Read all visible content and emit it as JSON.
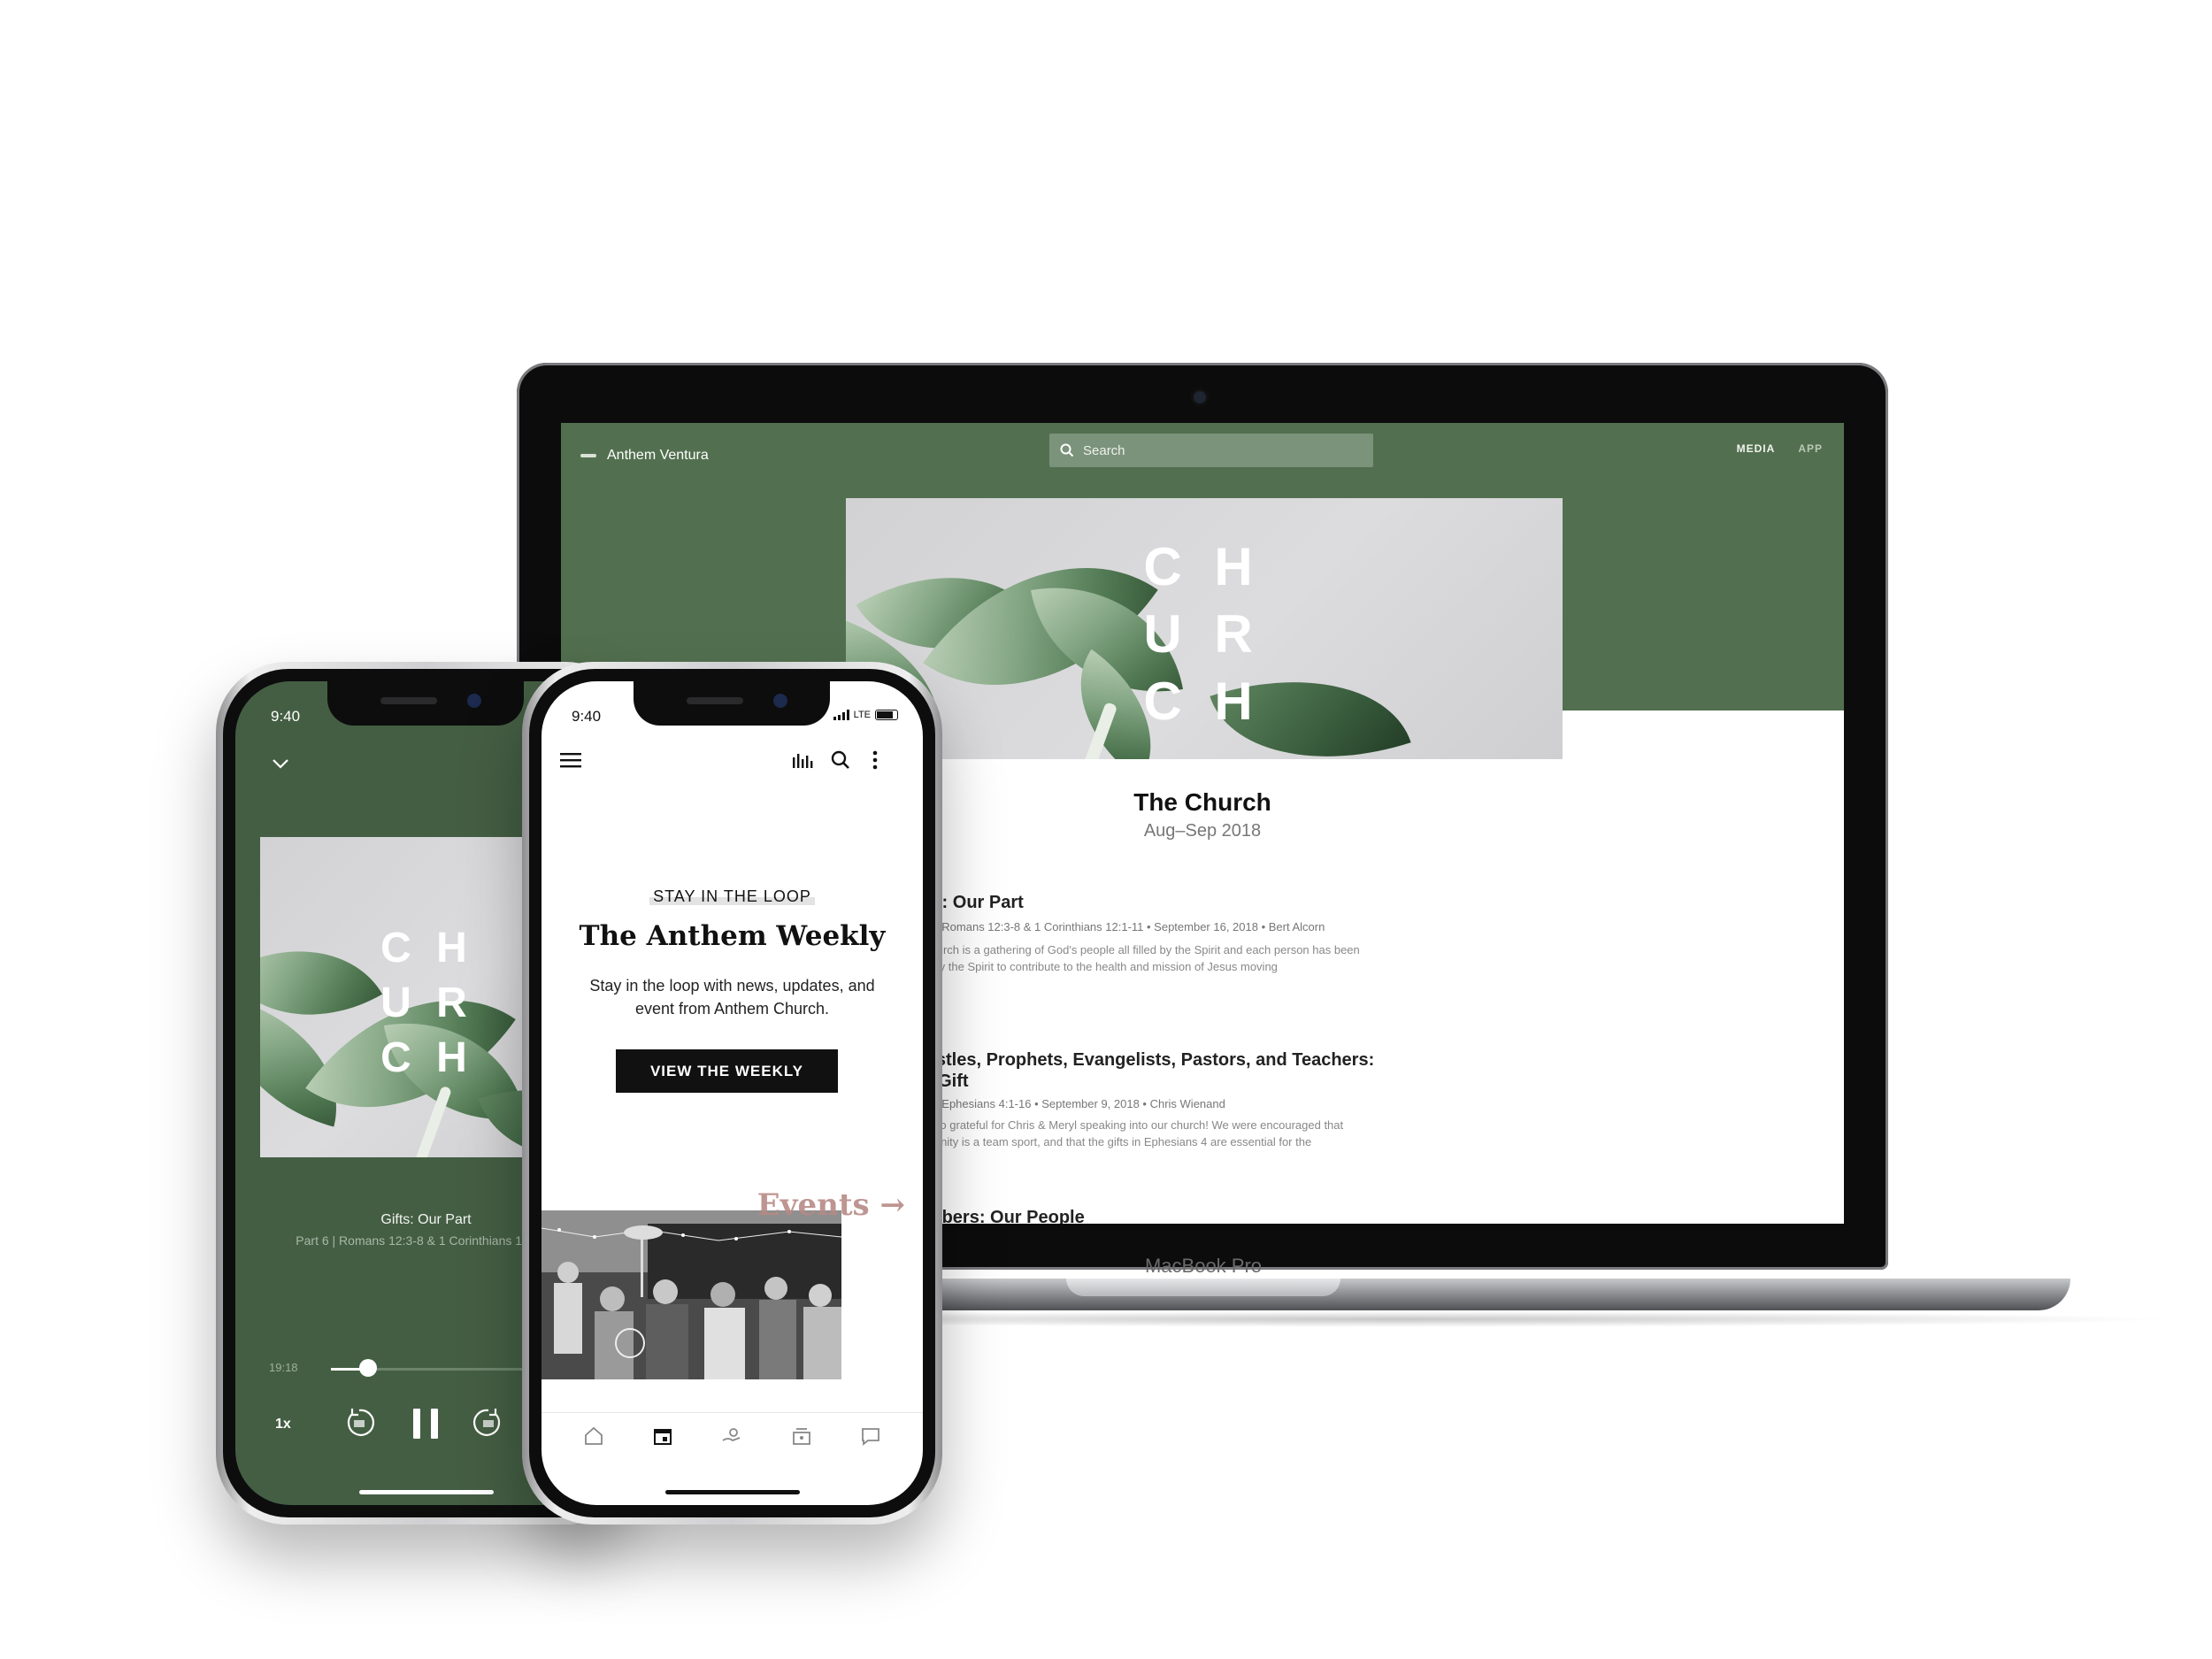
{
  "colors": {
    "brand_green": "#52704f",
    "player_green": "#445e43",
    "events_accent": "#b88a86",
    "cta_black": "#111111"
  },
  "artwork": {
    "letters": [
      "C",
      "H",
      "U",
      "R",
      "C",
      "H"
    ]
  },
  "laptop": {
    "brand_label": "MacBook Pro",
    "site": {
      "logo_text": "Anthem Ventura",
      "search_placeholder": "Search",
      "nav": [
        "MEDIA",
        "APP"
      ],
      "series_title": "The Church",
      "series_dates": "Aug–Sep 2018",
      "episodes": [
        {
          "title": "Gifts: Our Part",
          "meta": "Part 6 | Romans 12:3-8 & 1 Corinthians 12:1-11 • September 16, 2018 • Bert Alcorn",
          "desc": "The church is a gathering of God's people all filled by the Spirit and each person has been gifted by the Spirit to contribute to the health and mission of Jesus moving"
        },
        {
          "title": "Apostles, Prophets, Evangelists, Pastors, and Teachers: Our Gift",
          "meta": "Part 5 | Ephesians 4:1-16 • September 9, 2018 • Chris Wienand",
          "desc": "We're so grateful for Chris & Meryl speaking into our church! We were encouraged that Christianity is a team sport, and that the gifts in Ephesians 4 are essential for the"
        },
        {
          "title": "Members: Our People",
          "meta": "",
          "desc": ""
        }
      ]
    }
  },
  "player_phone": {
    "time": "9:40",
    "track_title": "Gifts: Our Part",
    "track_subtitle": "Part 6 | Romans 12:3-8 & 1 Corinthians 12:1-11",
    "elapsed": "19:18",
    "progress": 0.14,
    "speed": "1x",
    "icons": [
      "chevron-down-icon",
      "rewind-15-icon",
      "pause-icon",
      "forward-15-icon"
    ]
  },
  "app_phone": {
    "time": "9:40",
    "carrier": "LTE",
    "header_icons": [
      "menu-icon",
      "audio-bars-icon",
      "search-icon",
      "more-vertical-icon"
    ],
    "kicker": "STAY IN THE LOOP",
    "heading": "The Anthem Weekly",
    "body": "Stay in the loop with news, updates, and event from Anthem Church.",
    "cta_label": "VIEW THE WEEKLY",
    "events_label": "Events →",
    "tabs": [
      "home-icon",
      "calendar-icon",
      "giving-icon",
      "media-icon",
      "chat-icon"
    ]
  }
}
